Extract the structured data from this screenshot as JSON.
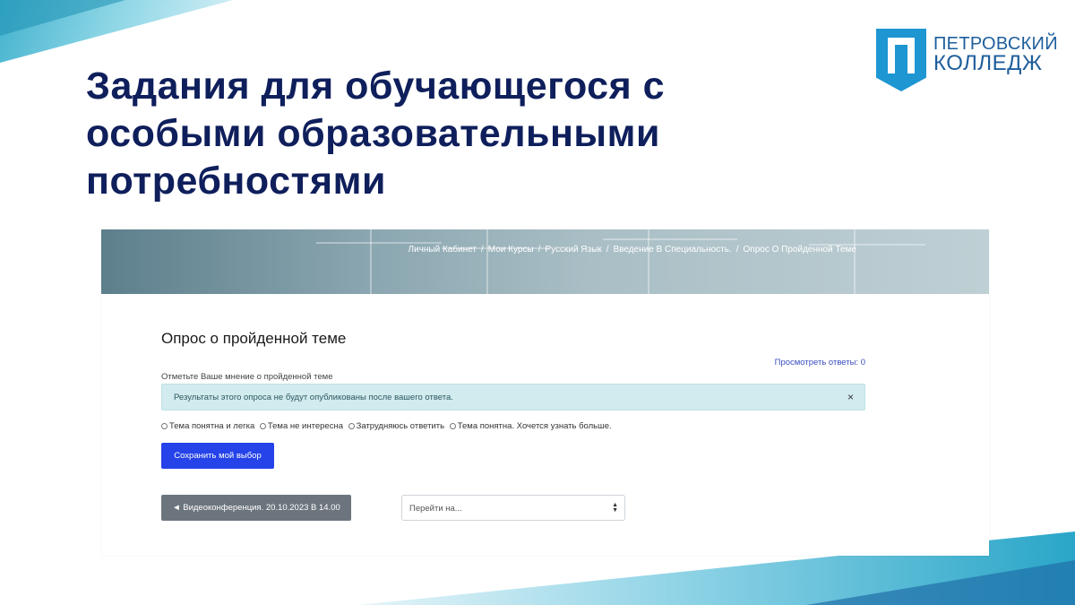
{
  "slide": {
    "title": "Задания для обучающегося  с особыми образовательными потребностями"
  },
  "logo": {
    "line1": "ПЕТРОВСКИЙ",
    "line2": "КОЛЛЕДЖ"
  },
  "breadcrumb": {
    "items": [
      "Личный Кабинет",
      "Мои Курсы",
      "Русский Язык",
      "Введение В Специальность.",
      "Опрос О Пройденной Теме"
    ],
    "separator": "/"
  },
  "page": {
    "title": "Опрос о пройденной теме",
    "view_answers": "Просмотреть ответы: 0",
    "description": "Отметьте Ваше мнение о пройденной теме",
    "alert": "Результаты этого опроса не будут опубликованы после вашего ответа.",
    "close_symbol": "×",
    "options": [
      "Тема понятна и легка",
      "Тема не интересна",
      "Затрудняюсь ответить",
      "Тема понятна. Хочется узнать больше."
    ],
    "save_label": "Сохранить мой выбор",
    "prev_label": "◄ Видеоконференция. 20.10.2023 В 14.00",
    "jump_placeholder": "Перейти на..."
  },
  "colors": {
    "title": "#0f1f5c",
    "primary_button": "#2543e8",
    "secondary_button": "#6c757d",
    "alert_bg": "#d1ebef",
    "link": "#3a4dbf",
    "logo_blue": "#1d96d2"
  },
  "icons": {
    "close": "close-icon",
    "select_arrows": "chevron-updown-icon",
    "logo": "shield-logo-icon"
  }
}
